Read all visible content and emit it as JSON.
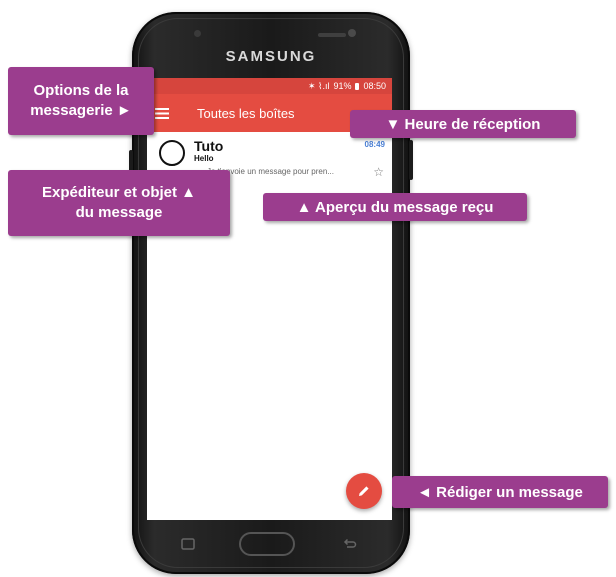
{
  "device": {
    "brand": "SAMSUNG"
  },
  "status_bar": {
    "signal_text": "✶ ⌇.ıl",
    "battery": "91%",
    "time": "08:50"
  },
  "app_bar": {
    "title": "Toutes les boîtes"
  },
  "message": {
    "sender": "Tuto",
    "subject": "Hello",
    "time": "08:49",
    "preview": "Je t'envoie un message pour pren...",
    "starred": false
  },
  "annotations": {
    "options_line1": "Options de la",
    "options_line2": "messagerie ►",
    "heure": "▼ Heure de réception",
    "expediteur_line1": "Expéditeur et objet ▲",
    "expediteur_line2": "du message",
    "apercu": "▲ Aperçu du message reçu",
    "rediger": "◄ Rédiger un message"
  },
  "colors": {
    "accent": "#e44c41",
    "status_bar": "#d6453d",
    "callout": "#9b3d8e",
    "time_blue": "#4a7fd4"
  }
}
